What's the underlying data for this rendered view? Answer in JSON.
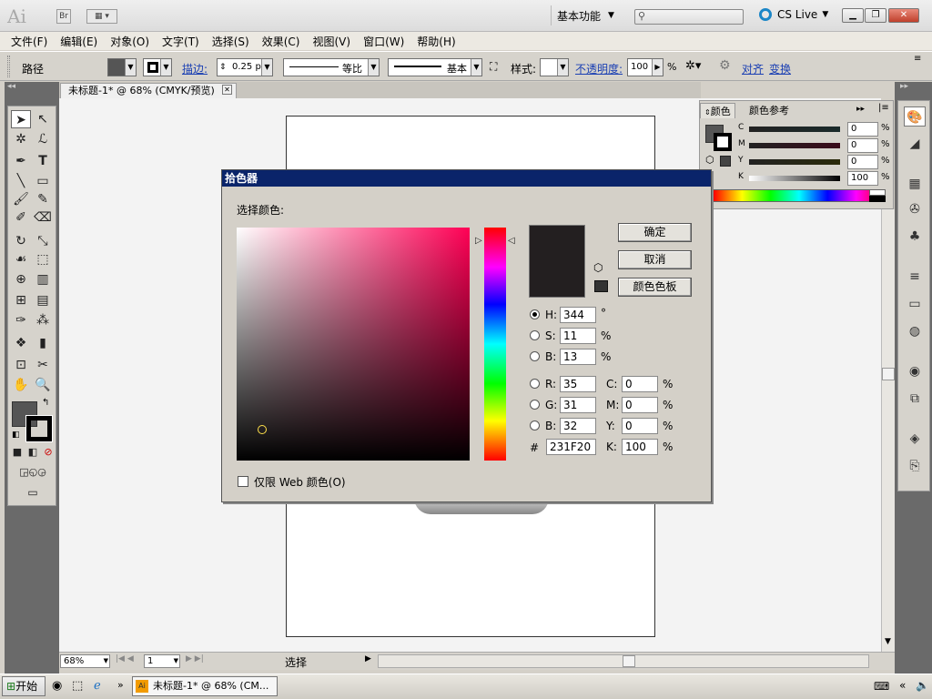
{
  "app": {
    "logo": "Ai",
    "bridge": "Br",
    "workspace": "基本功能",
    "cslive": "CS Live"
  },
  "menu": [
    "文件(F)",
    "编辑(E)",
    "对象(O)",
    "文字(T)",
    "选择(S)",
    "效果(C)",
    "视图(V)",
    "窗口(W)",
    "帮助(H)"
  ],
  "control": {
    "type_label": "路径",
    "stroke_link": "描边:",
    "stroke_weight": "0.25 pt",
    "profile_label": "等比",
    "brush_label": "基本",
    "style_label": "样式:",
    "opacity_link": "不透明度:",
    "opacity_value": "100",
    "opacity_unit": "%",
    "align_link": "对齐",
    "transform_link": "变换"
  },
  "doc_tab": "未标题-1* @ 68% (CMYK/预览)",
  "color_panel": {
    "tab1": "颜色",
    "tab2": "颜色参考",
    "channels": [
      {
        "label": "C",
        "value": "0"
      },
      {
        "label": "M",
        "value": "0"
      },
      {
        "label": "Y",
        "value": "0"
      },
      {
        "label": "K",
        "value": "100"
      }
    ],
    "unit": "%"
  },
  "dialog": {
    "title": "拾色器",
    "select_label": "选择颜色:",
    "ok": "确定",
    "cancel": "取消",
    "swatches": "颜色色板",
    "h_label": "H:",
    "h_value": "344",
    "h_unit": "°",
    "s_label": "S:",
    "s_value": "11",
    "s_unit": "%",
    "b_label": "B:",
    "b_value": "13",
    "b_unit": "%",
    "r_label": "R:",
    "r_value": "35",
    "g_label": "G:",
    "g_value": "31",
    "bl_label": "B:",
    "bl_value": "32",
    "c_label": "C:",
    "c_value": "0",
    "c_unit": "%",
    "m_label": "M:",
    "m_value": "0",
    "m_unit": "%",
    "y_label": "Y:",
    "y_value": "0",
    "y_unit": "%",
    "k_label": "K:",
    "k_value": "100",
    "k_unit": "%",
    "hex_label": "#",
    "hex_value": "231F20",
    "web_only": "仅限 Web 颜色(O)",
    "current_color": "#231F20"
  },
  "status": {
    "zoom": "68%",
    "page": "1",
    "mode": "选择"
  },
  "taskbar": {
    "start": "开始",
    "task": "未标题-1* @ 68% (CM..."
  }
}
